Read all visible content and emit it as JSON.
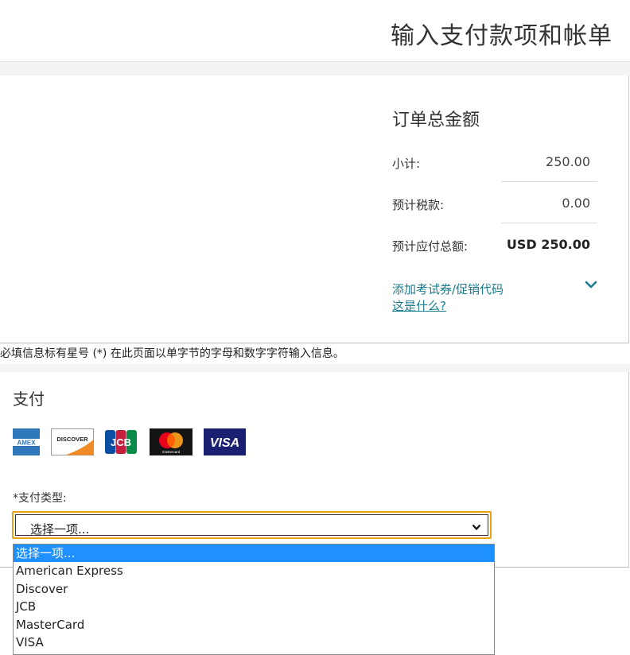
{
  "page": {
    "title": "输入支付款项和帐单"
  },
  "order_summary": {
    "title": "订单总金额",
    "subtotal_label": "小计:",
    "subtotal_value": "250.00",
    "tax_label": "预计税款:",
    "tax_value": "0.00",
    "total_label": "预计应付总额:",
    "total_value": "USD 250.00",
    "promo_link": "添加考试券/促销代码",
    "whatis_link": "这是什么?"
  },
  "required_note": "必填信息标有星号 (*) 在此页面以单字节的字母和数字字符输入信息。",
  "payment": {
    "title": "支付",
    "cards": [
      "amex-icon",
      "discover-icon",
      "jcb-icon",
      "mastercard-icon",
      "visa-icon"
    ],
    "card_text": {
      "amex": "AMEX",
      "discover": "DISCOVER",
      "jcb": "JCB",
      "mastercard": "mastercard",
      "visa": "VISA"
    },
    "type_label": "*支付类型:",
    "select_value": "选择一项...",
    "options": [
      "选择一项...",
      "American Express",
      "Discover",
      "JCB",
      "MasterCard",
      "VISA"
    ]
  },
  "colors": {
    "accent_link": "#1a7c8c",
    "focus_border": "#e8a317",
    "option_highlight": "#1e90ff"
  }
}
